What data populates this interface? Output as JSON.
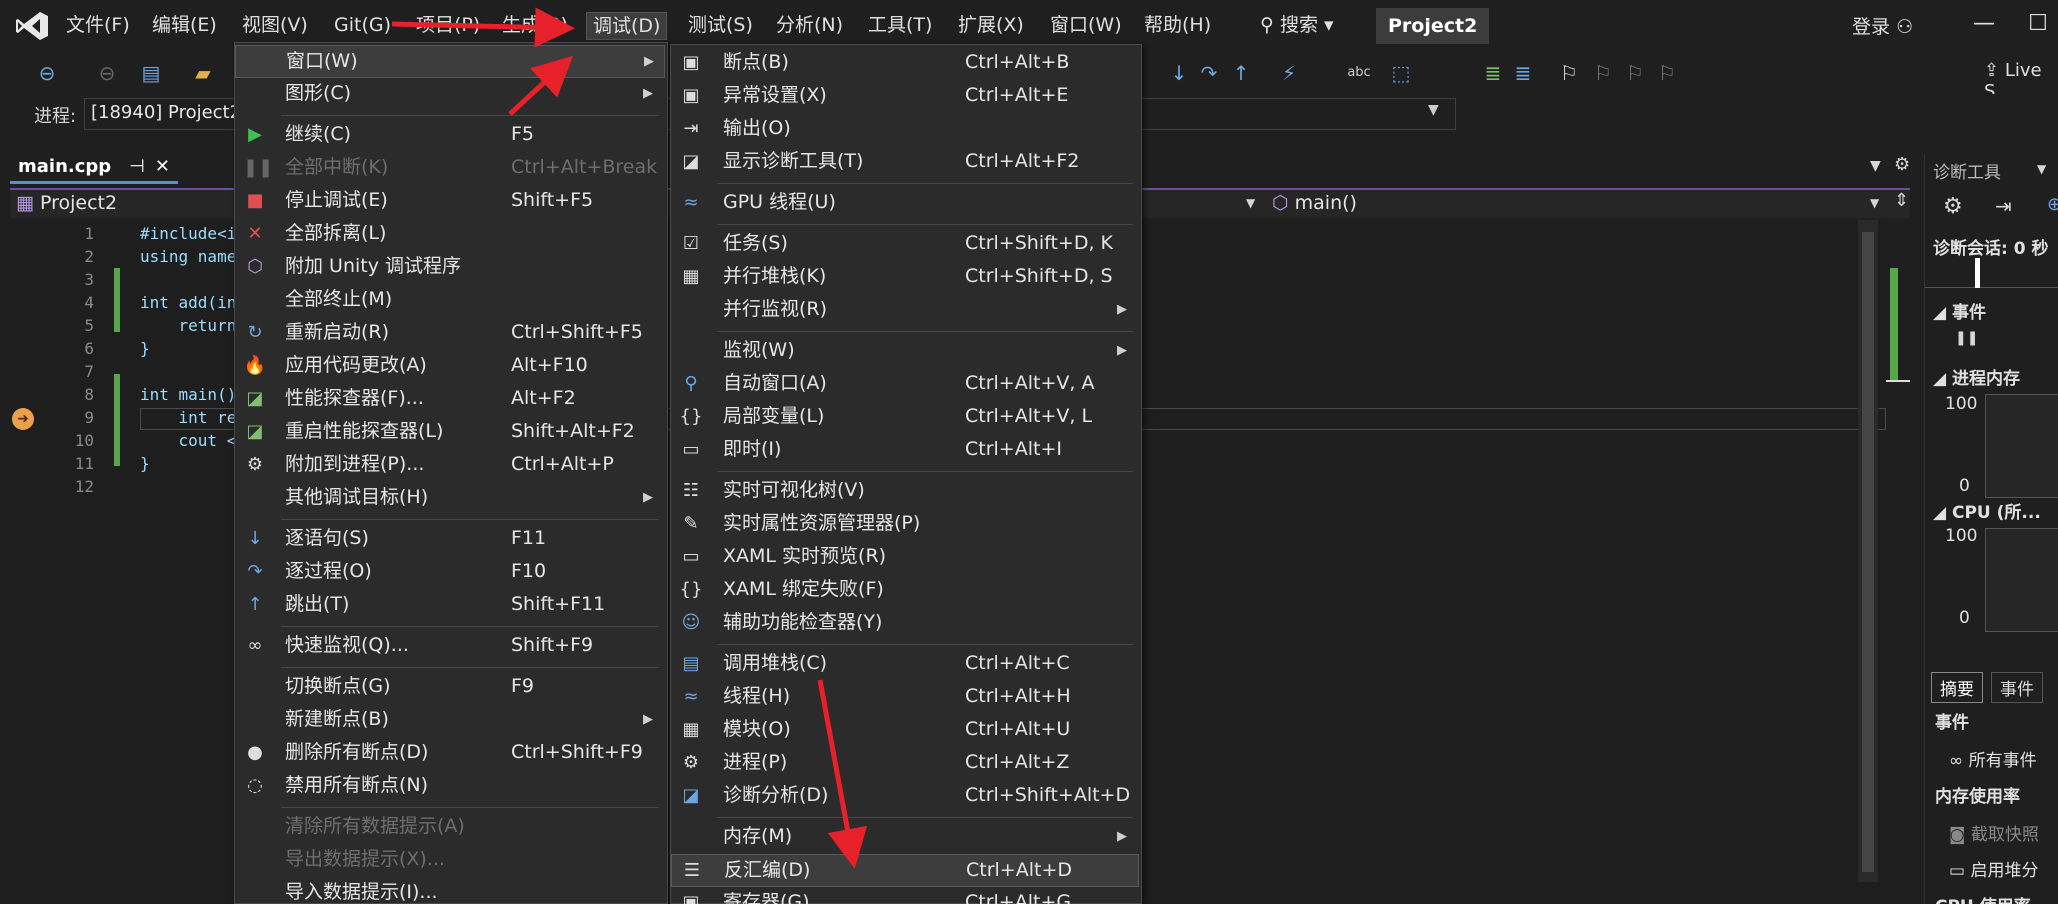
{
  "menubar": {
    "items": [
      "文件(F)",
      "编辑(E)",
      "视图(V)",
      "Git(G)",
      "项目(P)",
      "生成(B)",
      "调试(D)",
      "测试(S)",
      "分析(N)",
      "工具(T)",
      "扩展(X)",
      "窗口(W)",
      "帮助(H)"
    ],
    "search": "搜索",
    "project": "Project2",
    "login": "登录"
  },
  "toolbar": {
    "liveshare": "Live S"
  },
  "process": {
    "label": "进程:",
    "value": "[18940] Project2"
  },
  "tab": {
    "filename": "main.cpp"
  },
  "navbar": {
    "project": "Project2",
    "member": "main()"
  },
  "editor": {
    "lines": [
      {
        "n": "1",
        "code": "#include<i"
      },
      {
        "n": "2",
        "code": "using name"
      },
      {
        "n": "3",
        "code": ""
      },
      {
        "n": "4",
        "code": "int add(in"
      },
      {
        "n": "5",
        "code": "    return"
      },
      {
        "n": "6",
        "code": "}"
      },
      {
        "n": "7",
        "code": ""
      },
      {
        "n": "8",
        "code": "int main()"
      },
      {
        "n": "9",
        "code": "    int re"
      },
      {
        "n": "10",
        "code": "    cout <"
      },
      {
        "n": "11",
        "code": "}"
      },
      {
        "n": "12",
        "code": ""
      }
    ]
  },
  "debug_menu": {
    "items": [
      {
        "label": "窗口(W)",
        "shortcut": "",
        "icon": "",
        "submenu": true,
        "highlight": true
      },
      {
        "label": "图形(C)",
        "shortcut": "",
        "icon": "",
        "submenu": true
      },
      {
        "label": "继续(C)",
        "shortcut": "F5",
        "icon": "play-icon"
      },
      {
        "label": "全部中断(K)",
        "shortcut": "Ctrl+Alt+Break",
        "icon": "pause-icon",
        "disabled": true
      },
      {
        "label": "停止调试(E)",
        "shortcut": "Shift+F5",
        "icon": "stop-icon"
      },
      {
        "label": "全部拆离(L)",
        "shortcut": "",
        "icon": "detach-icon"
      },
      {
        "label": "附加 Unity 调试程序",
        "shortcut": "",
        "icon": "unity-icon"
      },
      {
        "label": "全部终止(M)",
        "shortcut": "",
        "icon": ""
      },
      {
        "label": "重新启动(R)",
        "shortcut": "Ctrl+Shift+F5",
        "icon": "restart-icon"
      },
      {
        "label": "应用代码更改(A)",
        "shortcut": "Alt+F10",
        "icon": "hot-reload-icon"
      },
      {
        "label": "性能探查器(F)...",
        "shortcut": "Alt+F2",
        "icon": "profiler-icon"
      },
      {
        "label": "重启性能探查器(L)",
        "shortcut": "Shift+Alt+F2",
        "icon": "profiler-restart-icon"
      },
      {
        "label": "附加到进程(P)...",
        "shortcut": "Ctrl+Alt+P",
        "icon": "attach-gear-icon"
      },
      {
        "label": "其他调试目标(H)",
        "shortcut": "",
        "icon": "",
        "submenu": true
      },
      {
        "label": "逐语句(S)",
        "shortcut": "F11",
        "icon": "step-into-icon"
      },
      {
        "label": "逐过程(O)",
        "shortcut": "F10",
        "icon": "step-over-icon"
      },
      {
        "label": "跳出(T)",
        "shortcut": "Shift+F11",
        "icon": "step-out-icon"
      },
      {
        "label": "快速监视(Q)...",
        "shortcut": "Shift+F9",
        "icon": "glasses-icon"
      },
      {
        "label": "切换断点(G)",
        "shortcut": "F9",
        "icon": ""
      },
      {
        "label": "新建断点(B)",
        "shortcut": "",
        "icon": "",
        "submenu": true
      },
      {
        "label": "删除所有断点(D)",
        "shortcut": "Ctrl+Shift+F9",
        "icon": "delete-breakpoints-icon"
      },
      {
        "label": "禁用所有断点(N)",
        "shortcut": "",
        "icon": "disable-breakpoints-icon"
      },
      {
        "label": "清除所有数据提示(A)",
        "shortcut": "",
        "icon": "",
        "disabled": true
      },
      {
        "label": "导出数据提示(X)...",
        "shortcut": "",
        "icon": "",
        "disabled": true
      },
      {
        "label": "导入数据提示(I)...",
        "shortcut": "",
        "icon": ""
      }
    ]
  },
  "window_submenu": {
    "items": [
      {
        "label": "断点(B)",
        "shortcut": "Ctrl+Alt+B",
        "icon": "breakpoints-window-icon"
      },
      {
        "label": "异常设置(X)",
        "shortcut": "Ctrl+Alt+E",
        "icon": "exception-settings-icon"
      },
      {
        "label": "输出(O)",
        "shortcut": "",
        "icon": "output-icon"
      },
      {
        "label": "显示诊断工具(T)",
        "shortcut": "Ctrl+Alt+F2",
        "icon": "diagnostics-icon"
      },
      {
        "label": "GPU 线程(U)",
        "shortcut": "",
        "icon": "gpu-threads-icon"
      },
      {
        "label": "任务(S)",
        "shortcut": "Ctrl+Shift+D, K",
        "icon": "tasks-icon"
      },
      {
        "label": "并行堆栈(K)",
        "shortcut": "Ctrl+Shift+D, S",
        "icon": "parallel-stacks-icon"
      },
      {
        "label": "并行监视(R)",
        "shortcut": "",
        "icon": "",
        "submenu": true
      },
      {
        "label": "监视(W)",
        "shortcut": "",
        "icon": "",
        "submenu": true
      },
      {
        "label": "自动窗口(A)",
        "shortcut": "Ctrl+Alt+V, A",
        "icon": "autos-icon"
      },
      {
        "label": "局部变量(L)",
        "shortcut": "Ctrl+Alt+V, L",
        "icon": "locals-icon"
      },
      {
        "label": "即时(I)",
        "shortcut": "Ctrl+Alt+I",
        "icon": "immediate-icon"
      },
      {
        "label": "实时可视化树(V)",
        "shortcut": "",
        "icon": "visual-tree-icon"
      },
      {
        "label": "实时属性资源管理器(P)",
        "shortcut": "",
        "icon": "property-explorer-icon"
      },
      {
        "label": "XAML 实时预览(R)",
        "shortcut": "",
        "icon": "xaml-preview-icon"
      },
      {
        "label": "XAML 绑定失败(F)",
        "shortcut": "",
        "icon": "xaml-binding-icon"
      },
      {
        "label": "辅助功能检查器(Y)",
        "shortcut": "",
        "icon": "accessibility-icon"
      },
      {
        "label": "调用堆栈(C)",
        "shortcut": "Ctrl+Alt+C",
        "icon": "call-stack-icon"
      },
      {
        "label": "线程(H)",
        "shortcut": "Ctrl+Alt+H",
        "icon": "threads-icon"
      },
      {
        "label": "模块(O)",
        "shortcut": "Ctrl+Alt+U",
        "icon": "modules-icon"
      },
      {
        "label": "进程(P)",
        "shortcut": "Ctrl+Alt+Z",
        "icon": "processes-icon"
      },
      {
        "label": "诊断分析(D)",
        "shortcut": "Ctrl+Shift+Alt+D",
        "icon": "diagnostic-analysis-icon"
      },
      {
        "label": "内存(M)",
        "shortcut": "",
        "icon": "",
        "submenu": true
      },
      {
        "label": "反汇编(D)",
        "shortcut": "Ctrl+Alt+D",
        "icon": "disassembly-icon",
        "highlight": true
      },
      {
        "label": "寄存器(G)",
        "shortcut": "Ctrl+Alt+G",
        "icon": "registers-icon"
      }
    ]
  },
  "diag_panel": {
    "title": "诊断工具",
    "session": "诊断会话: 0 秒",
    "events": "事件",
    "memory": "进程内存",
    "mem_max": "100",
    "mem_min": "0",
    "cpu": "CPU (所...",
    "cpu_max": "100",
    "cpu_min": "0",
    "tabs": [
      "摘要",
      "事件"
    ],
    "events_header": "事件",
    "all_events": "所有事件",
    "mem_usage": "内存使用率",
    "snapshot": "截取快照",
    "heap": "启用堆分",
    "cpu_usage": "CPU 使用率"
  },
  "colors": {
    "accent": "#5b8bd5",
    "arrow": "#e8202a",
    "background": "#1f1f1f"
  }
}
